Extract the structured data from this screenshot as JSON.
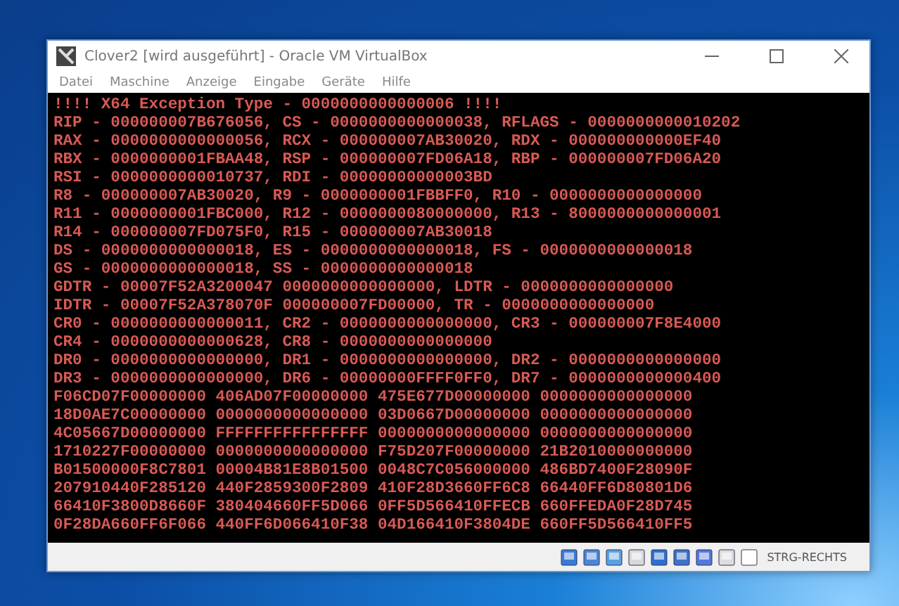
{
  "window": {
    "title": "Clover2 [wird ausgeführt] - Oracle VM VirtualBox"
  },
  "menu": [
    "Datei",
    "Maschine",
    "Anzeige",
    "Eingabe",
    "Geräte",
    "Hilfe"
  ],
  "console": {
    "lines": [
      "!!!! X64 Exception Type - 0000000000000006 !!!!",
      "RIP - 000000007B676056, CS - 0000000000000038, RFLAGS - 0000000000010202",
      "RAX - 0000000000000056, RCX - 000000007AB30020, RDX - 000000000000EF40",
      "RBX - 0000000001FBAA48, RSP - 000000007FD06A18, RBP - 000000007FD06A20",
      "RSI - 0000000000010737, RDI - 00000000000003BD",
      "R8 - 000000007AB30020, R9 - 0000000001FBBFF0, R10 - 0000000000000000",
      "R11 - 0000000001FBC000, R12 - 0000000080000000, R13 - 8000000000000001",
      "R14 - 000000007FD075F0, R15 - 000000007AB30018",
      "DS - 0000000000000018, ES - 0000000000000018, FS - 0000000000000018",
      "GS - 0000000000000018, SS - 0000000000000018",
      "GDTR - 00007F52A3200047 0000000000000000, LDTR - 0000000000000000",
      "IDTR - 00007F52A378070F 000000007FD00000, TR - 0000000000000000",
      "CR0 - 0000000000000011, CR2 - 0000000000000000, CR3 - 000000007F8E4000",
      "CR4 - 0000000000000628, CR8 - 0000000000000000",
      "DR0 - 0000000000000000, DR1 - 0000000000000000, DR2 - 0000000000000000",
      "DR3 - 0000000000000000, DR6 - 00000000FFFF0FF0, DR7 - 0000000000000400",
      "F06CD07F00000000 406AD07F00000000 475E677D00000000 0000000000000000",
      "18D0AE7C00000000 0000000000000000 03D0667D00000000 0000000000000000",
      "4C05667D00000000 FFFFFFFFFFFFFFFF 0000000000000000 0000000000000000",
      "1710227F00000000 0000000000000000 F75D207F00000000 21B2010000000000",
      "B01500000F8C7801 00004B81E8B01500 0048C7C056000000 486BD7400F28090F",
      "207910440F285120 440F2859300F2809 410F28D3660FF6C8 66440FF6D80801D6",
      "66410F3800D8660F 380404660FF5D066 0FF5D566410FFECB 660FFEDA0F28D745",
      "0F28DA660FF6F066 440FF6D066410F38 04D166410F3804DE 660FF5D566410FF5"
    ]
  },
  "status_bar": {
    "host_key": "STRG-RECHTS"
  }
}
